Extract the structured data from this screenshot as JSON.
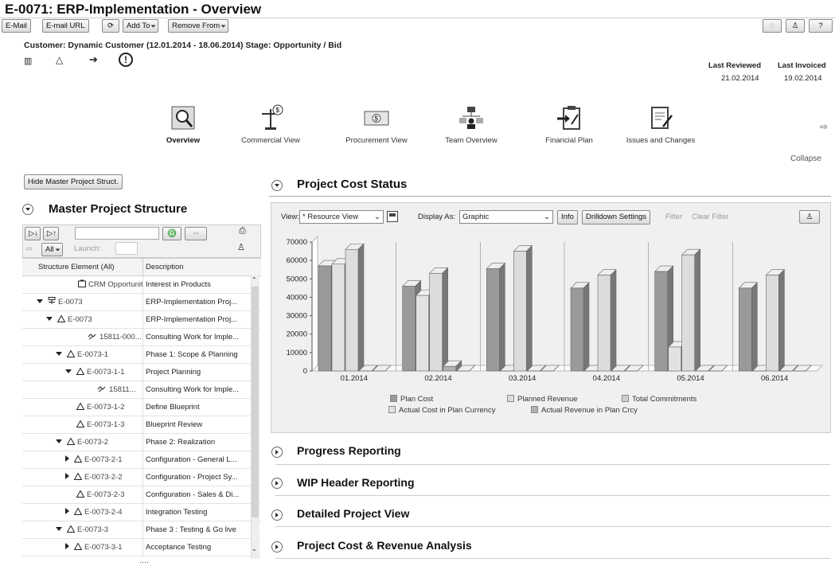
{
  "page": {
    "title": "E-0071: ERP-Implementation - Overview"
  },
  "toolbar": {
    "email": "E-Mail",
    "email_url": "E-mail URL",
    "add_to": "Add To",
    "remove_from": "Remove From"
  },
  "header": {
    "customer": "Customer: Dynamic Customer (12.01.2014 - 18.06.2014) Stage: Opportunity / Bid",
    "last_reviewed_label": "Last Reviewed",
    "last_reviewed_value": "21.02.2014",
    "last_invoiced_label": "Last Invoiced",
    "last_invoiced_value": "19.02.2014"
  },
  "nav": {
    "items": [
      "Overview",
      "Commercial View",
      "Procurement View",
      "Team Overview",
      "Financial Plan",
      "Issues and Changes"
    ],
    "collapse": "Collapse"
  },
  "left": {
    "hide_button": "Hide Master Project Struct.",
    "section_title": "Master Project Structure",
    "all_label": "All",
    "launch_label": "Launch:",
    "col1": "Structure Element (All)",
    "col2": "Description",
    "rows": [
      {
        "el": "CRM Opportunity...",
        "desc": "Interest in Products"
      },
      {
        "el": "E-0073",
        "desc": "ERP-Implementation Proj..."
      },
      {
        "el": "E-0073",
        "desc": "ERP-Implementation Proj..."
      },
      {
        "el": "15811-000...",
        "desc": "Consulting Work for Imple..."
      },
      {
        "el": "E-0073-1",
        "desc": "Phase 1: Scope & Planning"
      },
      {
        "el": "E-0073-1-1",
        "desc": "Project Planning"
      },
      {
        "el": "15811...",
        "desc": "Consulting Work for Imple..."
      },
      {
        "el": "E-0073-1-2",
        "desc": "Define Blueprint"
      },
      {
        "el": "E-0073-1-3",
        "desc": "Blueprint Review"
      },
      {
        "el": "E-0073-2",
        "desc": "Phase 2: Realization"
      },
      {
        "el": "E-0073-2-1",
        "desc": "Configuration - General L..."
      },
      {
        "el": "E-0073-2-2",
        "desc": "Configuration - Project Sy..."
      },
      {
        "el": "E-0073-2-3",
        "desc": "Configuration - Sales & Di..."
      },
      {
        "el": "E-0073-2-4",
        "desc": "Integration Testing"
      },
      {
        "el": "E-0073-3",
        "desc": "Phase 3 : Testing & Go live"
      },
      {
        "el": "E-0073-3-1",
        "desc": "Acceptance Testing"
      }
    ]
  },
  "cost": {
    "section_title": "Project Cost Status",
    "view_label": "View:",
    "view_value": "* Resource View",
    "display_label": "Display As:",
    "display_value": "Graphic",
    "info": "Info",
    "drilldown": "Drilldown Settings",
    "filter": "Filter",
    "clear_filter": "Clear Filter"
  },
  "sections": [
    "Progress Reporting",
    "WIP Header Reporting",
    "Detailed Project View",
    "Project Cost & Revenue Analysis"
  ],
  "chart_data": {
    "type": "bar",
    "categories": [
      "01.2014",
      "02.2014",
      "03.2014",
      "04.2014",
      "05.2014",
      "06.2014"
    ],
    "ylim": [
      0,
      70000
    ],
    "yticks": [
      0,
      10000,
      20000,
      30000,
      40000,
      50000,
      60000,
      70000
    ],
    "series": [
      {
        "name": "Plan Cost",
        "color": "#9a9a9a",
        "values": [
          57000,
          46000,
          55500,
          45000,
          54000,
          45000
        ]
      },
      {
        "name": "Actual Cost in Plan Currency",
        "color": "#e2e2e2",
        "values": [
          58000,
          41000,
          0,
          0,
          13000,
          0
        ]
      },
      {
        "name": "Planned Revenue",
        "color": "#dcdcdc",
        "values": [
          66000,
          53000,
          65000,
          52000,
          63000,
          52000
        ]
      },
      {
        "name": "Actual Revenue in Plan Crcy",
        "color": "#b0b0b0",
        "values": [
          0,
          2500,
          0,
          0,
          0,
          0
        ]
      },
      {
        "name": "Total Commitments",
        "color": "#cfcfcf",
        "values": [
          0,
          0,
          0,
          0,
          0,
          0
        ]
      }
    ],
    "legend": [
      "Plan Cost",
      "Planned Revenue",
      "Total Commitments",
      "Actual Cost in Plan Currency",
      "Actual Revenue in Plan Crcy"
    ]
  }
}
